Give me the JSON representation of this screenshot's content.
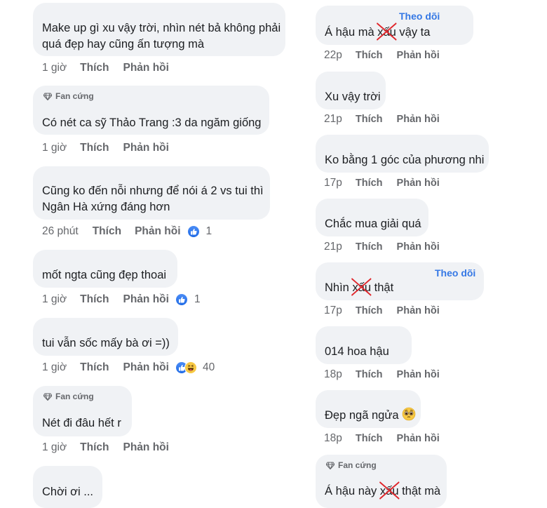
{
  "colors": {
    "bubble": "#f0f2f5",
    "meta": "#65676b",
    "follow": "#3578e5",
    "strike": "#e0262b",
    "like": "#1f6be6"
  },
  "actions": {
    "like": "Thích",
    "reply": "Phản hồi",
    "follow": "Theo dõi",
    "fan_badge": "Fan cứng"
  },
  "left_comments": [
    {
      "lines": [
        "Make up gì xu vậy trời, nhìn nét bả không phải",
        "quá đẹp hay cũng ấn tượng mà"
      ],
      "time": "1 giờ"
    },
    {
      "badge": "Fan cứng",
      "lines": [
        "Có nét ca sỹ Thảo Trang :3 da ngăm giống"
      ],
      "time": "1 giờ"
    },
    {
      "lines": [
        "Cũng ko đến nỗi nhưng để nói á 2 vs tui thì",
        "Ngân Hà xứng đáng hơn"
      ],
      "time": "26 phút",
      "reactions": [
        "like"
      ],
      "reaction_count": "1"
    },
    {
      "lines": [
        "mốt ngta cũng đẹp thoai"
      ],
      "time": "1 giờ",
      "reactions": [
        "like"
      ],
      "reaction_count": "1"
    },
    {
      "lines": [
        "tui vẫn sốc mấy bà ơi =))"
      ],
      "time": "1 giờ",
      "reactions": [
        "like",
        "haha"
      ],
      "reaction_count": "40"
    },
    {
      "badge": "Fan cứng",
      "lines": [
        "Nét đi đâu hết r"
      ],
      "time": "1 giờ"
    },
    {
      "lines": [
        "Chời ơi ..."
      ]
    }
  ],
  "right_comments": [
    {
      "follow": "Theo dõi",
      "text_pre": "Á hậu mà ",
      "struck": "xấu",
      "text_post": " vậy ta",
      "time": "22p"
    },
    {
      "text": "Xu vậy trời",
      "time": "21p"
    },
    {
      "text": "Ko bằng 1 góc của phương nhi",
      "time": "17p"
    },
    {
      "text": "Chắc mua giải quá",
      "time": "21p"
    },
    {
      "follow": "Theo dõi",
      "text_pre": "Nhìn ",
      "struck": "xấu",
      "text_post": " thật",
      "time": "17p"
    },
    {
      "text": "014 hoa hậu",
      "time": "18p"
    },
    {
      "text": "Đẹp ngã ngửa",
      "emoji": "pleading-face",
      "time": "18p"
    },
    {
      "badge": "Fan cứng",
      "text_pre": "Á hậu này ",
      "struck": "xấu",
      "text_post": " thật mà"
    }
  ]
}
